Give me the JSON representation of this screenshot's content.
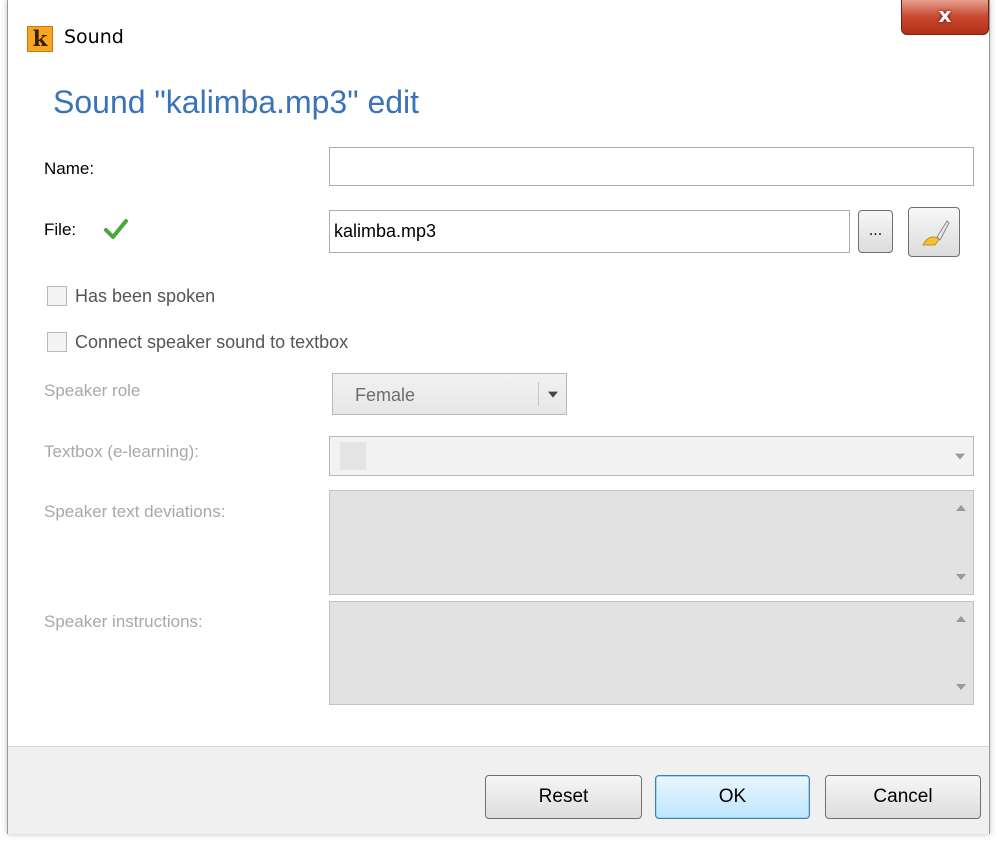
{
  "window": {
    "title": "Sound",
    "app_icon_letter": "k",
    "close_label": "x"
  },
  "form": {
    "heading": "Sound \"kalimba.mp3\" edit",
    "name_label": "Name:",
    "name_value": "",
    "file_label": "File:",
    "file_value": "kalimba.mp3",
    "browse_label": "...",
    "has_been_spoken_label": "Has been spoken",
    "connect_label": "Connect speaker sound to textbox",
    "speaker_role_label": "Speaker role",
    "speaker_role_value": "Female",
    "textbox_label": "Textbox (e-learning):",
    "textbox_value": "",
    "deviations_label": "Speaker text deviations:",
    "instructions_label": "Speaker instructions:"
  },
  "footer": {
    "reset_label": "Reset",
    "ok_label": "OK",
    "cancel_label": "Cancel"
  },
  "colors": {
    "heading": "#3b73b9",
    "check": "#4aa83a",
    "disabled_text": "#a8a8a8"
  },
  "icons": [
    "app-logo-icon",
    "close-icon",
    "check-icon",
    "browse-icon",
    "edit-brush-icon",
    "chevron-down-icon",
    "scroll-up-icon",
    "scroll-down-icon"
  ]
}
